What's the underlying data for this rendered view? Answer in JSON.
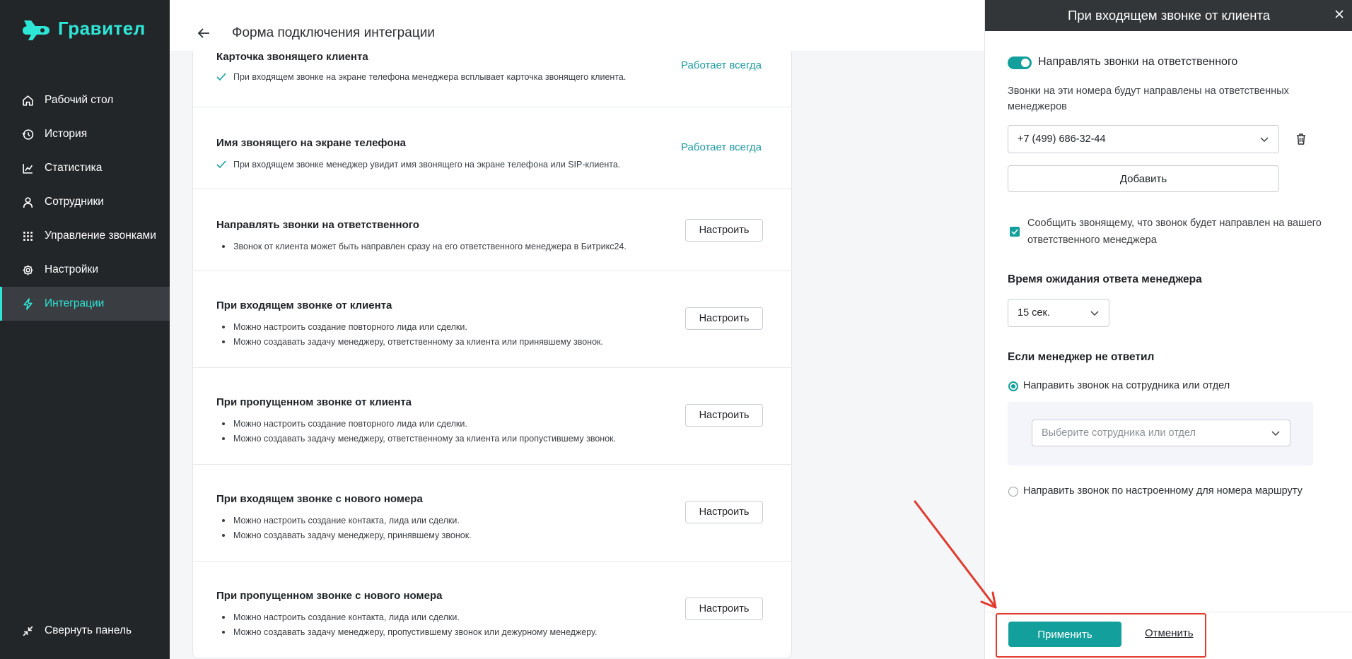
{
  "brand": {
    "name": "Гравител"
  },
  "sidebar": {
    "items": [
      {
        "label": "Рабочий стол",
        "icon": "home-icon"
      },
      {
        "label": "История",
        "icon": "history-icon"
      },
      {
        "label": "Статистика",
        "icon": "chart-icon"
      },
      {
        "label": "Сотрудники",
        "icon": "user-icon"
      },
      {
        "label": "Управление звонками",
        "icon": "grid-icon"
      },
      {
        "label": "Настройки",
        "icon": "gear-icon"
      },
      {
        "label": "Интеграции",
        "icon": "lightning-icon",
        "active": true
      }
    ],
    "collapse_label": "Свернуть панель"
  },
  "header": {
    "title": "Форма подключения интеграции"
  },
  "integration_rows": [
    {
      "title": "Карточка звонящего клиента",
      "lines": [
        "При входящем звонке на экране телефона менеджера всплывает карточка звонящего клиента."
      ],
      "status": "Работает всегда"
    },
    {
      "title": "Имя звонящего на экране телефона",
      "lines": [
        "При входящем звонке менеджер увидит имя звонящего на экране телефона или SIP-клиента."
      ],
      "status": "Работает всегда"
    },
    {
      "title": "Направлять звонки на ответственного",
      "lines": [
        "Звонок от клиента может быть направлен сразу на его ответственного менеджера в Битрикс24."
      ],
      "action": "Настроить"
    },
    {
      "title": "При входящем звонке от клиента",
      "lines": [
        "Можно настроить создание повторного лида или сделки.",
        "Можно создавать задачу менеджеру, ответственному за клиента или принявшему звонок."
      ],
      "action": "Настроить"
    },
    {
      "title": "При пропущенном звонке от клиента",
      "lines": [
        "Можно настроить создание повторного лида или сделки.",
        "Можно создавать задачу менеджеру, ответственному за клиента или пропустившему звонок."
      ],
      "action": "Настроить"
    },
    {
      "title": "При входящем звонке с нового номера",
      "lines": [
        "Можно настроить создание контакта, лида или сделки.",
        "Можно создавать задачу менеджеру, принявшему звонок."
      ],
      "action": "Настроить"
    },
    {
      "title": "При пропущенном звонке с нового номера",
      "lines": [
        "Можно настроить создание контакта, лида или сделки.",
        "Можно создавать задачу менеджеру, пропустившему звонок или дежурному менеджеру."
      ],
      "action": "Настроить"
    }
  ],
  "drawer": {
    "title": "При входящем звонке от клиента",
    "toggle_label": "Направлять звонки на ответственного",
    "toggle_on": true,
    "description": "Звонки на эти номера будут направлены на ответственных менеджеров",
    "phone_value": "+7 (499) 686-32-44",
    "add_label": "Добавить",
    "notify_checked": true,
    "notify_label": "Сообщить звонящему, что звонок будет направлен на вашего ответственного менеджера",
    "wait_title": "Время ожидания ответа менеджера",
    "wait_value": "15 сек.",
    "no_answer_title": "Если менеджер не ответил",
    "option_employee": "Направить звонок на сотрудника или отдел",
    "employee_placeholder": "Выберите сотрудника или отдел",
    "option_route": "Направить звонок по настроенному для номера маршруту",
    "apply_label": "Применить",
    "cancel_label": "Отменить"
  },
  "colors": {
    "accent": "#13a09c",
    "brand": "#2ee6d6",
    "sidebar_bg": "#232629",
    "annotation": "#e23b2e"
  }
}
